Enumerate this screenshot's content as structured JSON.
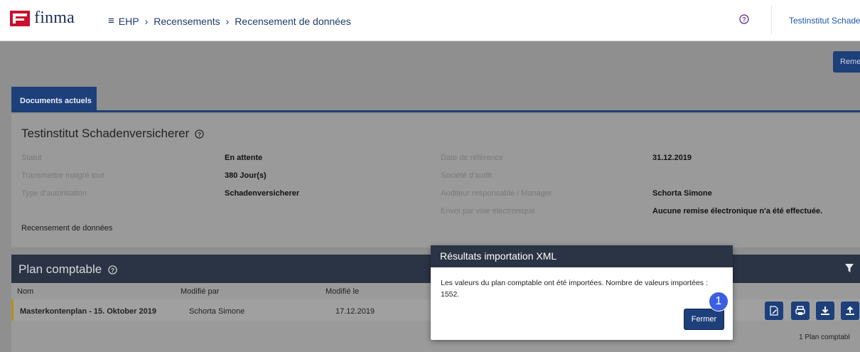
{
  "header": {
    "brand": "finma",
    "breadcrumb": [
      "EHP",
      "Recensements",
      "Recensement de données"
    ],
    "institute": "Testinstitut Schade"
  },
  "toolbar": {
    "remise_label": "Reme"
  },
  "tabs": [
    {
      "label": "Documents actuels"
    }
  ],
  "institute_card": {
    "title": "Testinstitut Schadenversicherer",
    "left_fields": [
      {
        "label": "Statut",
        "value": "En attente"
      },
      {
        "label": "Transmettre malgré tout",
        "value": "380 Jour(s)"
      },
      {
        "label": "Type d'autorisation",
        "value": "Schadenversicherer"
      }
    ],
    "right_fields": [
      {
        "label": "Date de référence",
        "value": "31.12.2019"
      },
      {
        "label": "Société d'audit",
        "value": ""
      },
      {
        "label": "Auditeur responsable / Manager",
        "value": "Schorta Simone"
      },
      {
        "label": "Envoi par voie électronique",
        "value": "Aucune remise électronique n'a été effectuée."
      }
    ],
    "footer_label": "Recensement de données"
  },
  "plan": {
    "title": "Plan comptable",
    "columns": [
      "Nom",
      "Modifié par",
      "Modifié le"
    ],
    "rows": [
      {
        "name": "Masterkontenplan - 15. Oktober 2019",
        "modified_by": "Schorta Simone",
        "modified_on": "17.12.2019"
      }
    ],
    "count_text": "1 Plan comptabl"
  },
  "modal": {
    "title": "Résultats importation XML",
    "message": "Les valeurs du plan comptable ont été importées. Nombre de valeurs importées : 1552.",
    "close_label": "Fermer",
    "step_number": "1"
  },
  "colors": {
    "navy": "#1d3f7a",
    "dark_header": "#2b3444",
    "row_accent": "#b98e17",
    "badge": "#3b5fe0"
  }
}
